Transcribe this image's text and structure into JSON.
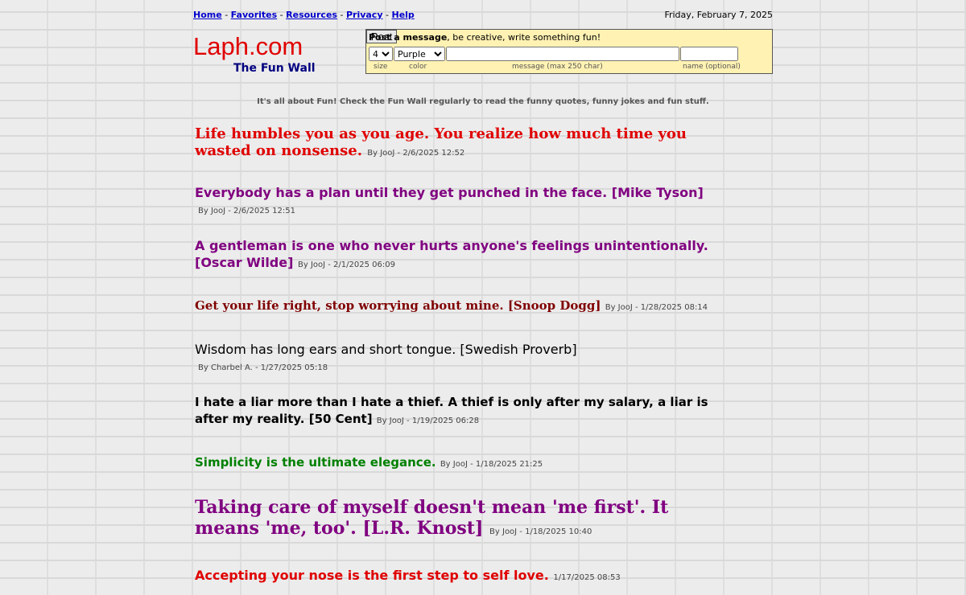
{
  "nav": {
    "items": [
      {
        "label": "Home"
      },
      {
        "label": "Favorites"
      },
      {
        "label": "Resources"
      },
      {
        "label": "Privacy"
      },
      {
        "label": "Help"
      }
    ],
    "separator": "-"
  },
  "date": "Friday, February 7, 2025",
  "logo": {
    "title": "Laph.com",
    "tagline": "The Fun Wall",
    "color": "#e00000"
  },
  "post": {
    "heading_bold": "Post a message",
    "heading_rest": ", be creative, write something fun!",
    "size_value": "4",
    "color_value": "Purple",
    "message_value": "",
    "name_value": "",
    "button": "Post",
    "hints": {
      "size": "size",
      "color": "color",
      "message": "message (max 250 char)",
      "name": "name (optional)"
    },
    "bg": "#fff2b3"
  },
  "intro": "It's all about Fun! Check the Fun Wall regularly to read the funny quotes, funny jokes and fun stuff.",
  "messages": [
    {
      "text": "Life humbles you as you age. You realize how much time you wasted on nonsense.",
      "by": "By JooJ - 2/6/2025 12:52",
      "color": "#e00000"
    },
    {
      "text": "Everybody has a plan until they get punched in the face. [Mike Tyson]",
      "by": "By JooJ - 2/6/2025 12:51",
      "color": "#800080"
    },
    {
      "text": "A gentleman is one who never hurts anyone's feelings unintentionally. [Oscar Wilde]",
      "by": "By JooJ - 2/1/2025 06:09",
      "color": "#800080"
    },
    {
      "text": "Get your life right, stop worrying about mine. [Snoop Dogg]",
      "by": "By JooJ - 1/28/2025 08:14",
      "color": "#800000"
    },
    {
      "text": "Wisdom has long ears and short tongue. [Swedish Proverb]",
      "by": "By Charbel A. - 1/27/2025 05:18",
      "color": "#000000"
    },
    {
      "text": "I hate a liar more than I hate a thief. A thief is only after my salary, a liar is after my reality. [50 Cent]",
      "by": "By JooJ - 1/19/2025 06:28",
      "color": "#000000"
    },
    {
      "text": "Simplicity is the ultimate elegance.",
      "by": "By JooJ - 1/18/2025 21:25",
      "color": "#008000"
    },
    {
      "text": "Taking care of myself doesn't mean 'me first'. It means 'me, too'. [L.R. Knost]",
      "by": "By JooJ - 1/18/2025 10:40",
      "color": "#800080"
    },
    {
      "text": "Accepting your nose is the first step to self love.",
      "by": "1/17/2025 08:53",
      "color": "#e00000"
    }
  ]
}
